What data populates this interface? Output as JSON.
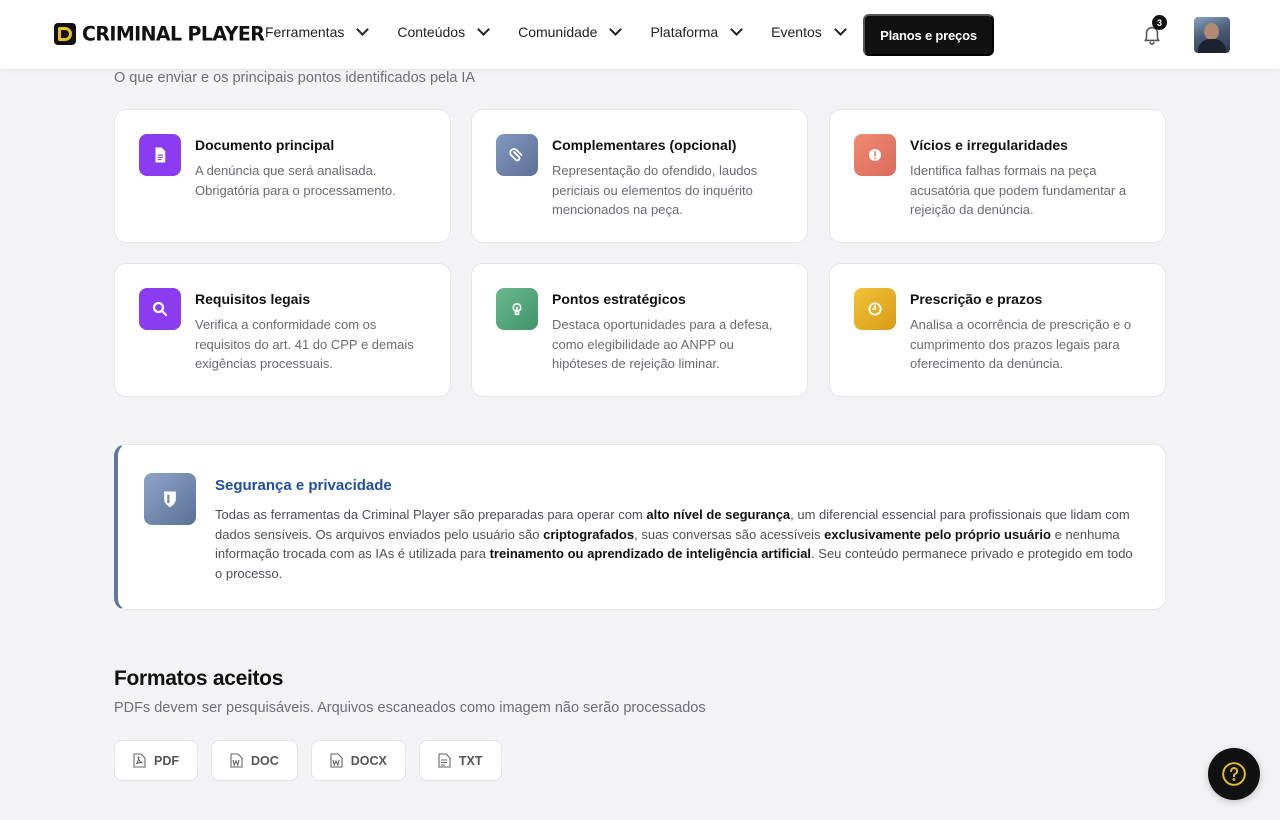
{
  "brand": {
    "name": "CRIMINAL PLAYER"
  },
  "nav": {
    "items": [
      {
        "label": "Ferramentas"
      },
      {
        "label": "Conteúdos"
      },
      {
        "label": "Comunidade"
      },
      {
        "label": "Plataforma"
      },
      {
        "label": "Eventos"
      }
    ],
    "cta_label": "Planos e preços",
    "notifications_count": "3"
  },
  "section_subtitle": "O que enviar e os principais pontos identificados pela IA",
  "cards": [
    {
      "icon": "document-icon",
      "color": "#8b3cf0",
      "title": "Documento principal",
      "description": "A denúncia que será analisada. Obrigatória para o processamento."
    },
    {
      "icon": "paperclip-icon",
      "color": "#6a7fa8",
      "title": "Complementares (opcional)",
      "description": "Representação do ofendido, laudos periciais ou elementos do inquérito mencionados na peça."
    },
    {
      "icon": "alert-icon",
      "color": "#e4725f",
      "title": "Vícios e irregularidades",
      "description": "Identifica falhas formais na peça acusatória que podem fundamentar a rejeição da denúncia."
    },
    {
      "icon": "search-icon",
      "color": "#8b3cf0",
      "title": "Requisitos legais",
      "description": "Verifica a conformidade com os requisitos do art. 41 do CPP e demais exigências processuais."
    },
    {
      "icon": "lightbulb-icon",
      "color": "#4ea57a",
      "title": "Pontos estratégicos",
      "description": "Destaca oportunidades para a defesa, como elegibilidade ao ANPP ou hipóteses de rejeição liminar."
    },
    {
      "icon": "clock-icon",
      "color": "#e0ab1d",
      "title": "Prescrição e prazos",
      "description": "Analisa a ocorrência de prescrição e o cumprimento dos prazos legais para oferecimento da denúncia."
    }
  ],
  "security": {
    "title": "Segurança e privacidade",
    "t1": "Todas as ferramentas da Criminal Player são preparadas para operar com ",
    "b1": "alto nível de segurança",
    "t2": ", um diferencial essencial para profissionais que lidam com dados sensíveis. Os arquivos enviados pelo usuário são ",
    "b2": "criptografados",
    "t3": ", suas conversas são acessíveis ",
    "b3": "exclusivamente pelo próprio usuário",
    "t4": " e nenhuma informação trocada com as IAs é utilizada para ",
    "b4": "treinamento ou aprendizado de inteligência artificial",
    "t5": ". Seu conteúdo permanece privado e protegido em todo o processo."
  },
  "formats": {
    "title": "Formatos aceitos",
    "subtitle": "PDFs devem ser pesquisáveis. Arquivos escaneados como imagem não serão processados",
    "items": [
      {
        "label": "PDF",
        "icon": "pdf-file-icon"
      },
      {
        "label": "DOC",
        "icon": "word-file-icon"
      },
      {
        "label": "DOCX",
        "icon": "word-file-icon"
      },
      {
        "label": "TXT",
        "icon": "text-file-icon"
      }
    ]
  }
}
